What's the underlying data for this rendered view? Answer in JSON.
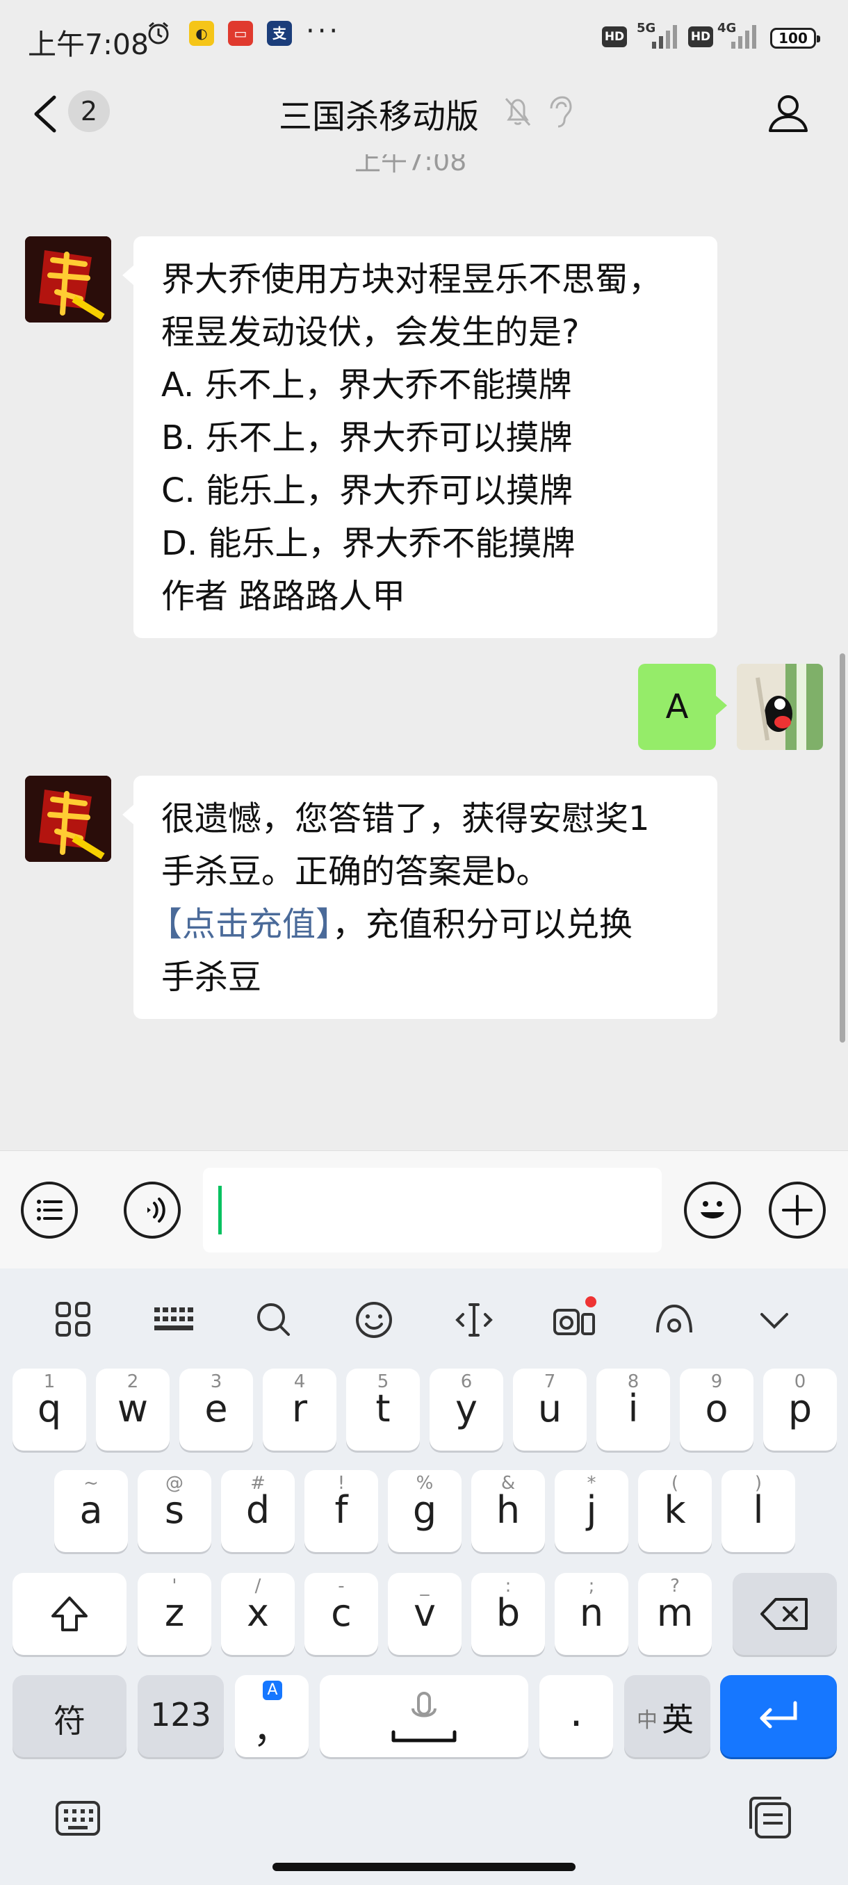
{
  "status": {
    "time": "上午7:08",
    "net1": "5G",
    "net2": "4G",
    "hd": "HD",
    "battery": "100",
    "more": "···"
  },
  "header": {
    "back_count": "2",
    "title": "三国杀移动版"
  },
  "chat": {
    "timestamp_partial": "上午7:08",
    "msg1_lines": [
      "界大乔使用方块对程昱乐不思蜀，",
      "程昱发动设伏，会发生的是?",
      "A. 乐不上，界大乔不能摸牌",
      "B. 乐不上，界大乔可以摸牌",
      "C. 能乐上，界大乔可以摸牌",
      "D. 能乐上，界大乔不能摸牌",
      "作者 路路路人甲"
    ],
    "my_reply": "A",
    "msg2_line1": "很遗憾，您答错了，获得安慰奖1",
    "msg2_line2": "手杀豆。正确的答案是b。",
    "msg2_link": "【点击充值】",
    "msg2_line3_rest": "，充值积分可以兑换",
    "msg2_line4": "手杀豆"
  },
  "keyboard": {
    "row1": [
      {
        "m": "q",
        "s": "1"
      },
      {
        "m": "w",
        "s": "2"
      },
      {
        "m": "e",
        "s": "3"
      },
      {
        "m": "r",
        "s": "4"
      },
      {
        "m": "t",
        "s": "5"
      },
      {
        "m": "y",
        "s": "6"
      },
      {
        "m": "u",
        "s": "7"
      },
      {
        "m": "i",
        "s": "8"
      },
      {
        "m": "o",
        "s": "9"
      },
      {
        "m": "p",
        "s": "0"
      }
    ],
    "row2": [
      {
        "m": "a",
        "s": "~"
      },
      {
        "m": "s",
        "s": "@"
      },
      {
        "m": "d",
        "s": "#"
      },
      {
        "m": "f",
        "s": "!"
      },
      {
        "m": "g",
        "s": "%"
      },
      {
        "m": "h",
        "s": "&"
      },
      {
        "m": "j",
        "s": "*"
      },
      {
        "m": "k",
        "s": "("
      },
      {
        "m": "l",
        "s": ")"
      }
    ],
    "row3": [
      {
        "m": "z",
        "s": "'"
      },
      {
        "m": "x",
        "s": "/"
      },
      {
        "m": "c",
        "s": "-"
      },
      {
        "m": "v",
        "s": "_"
      },
      {
        "m": "b",
        "s": ":"
      },
      {
        "m": "n",
        "s": ";"
      },
      {
        "m": "m",
        "s": "?"
      }
    ],
    "symbol_key": "符",
    "num_key": "123",
    "comma_key": "，",
    "comma_badge": "A",
    "period_key": ".",
    "lang_small": "中",
    "lang_big": "英"
  },
  "colors": {
    "accent": "#07c160",
    "my_bubble": "#95ec69",
    "link": "#4a6a99",
    "enter": "#1677ff"
  }
}
